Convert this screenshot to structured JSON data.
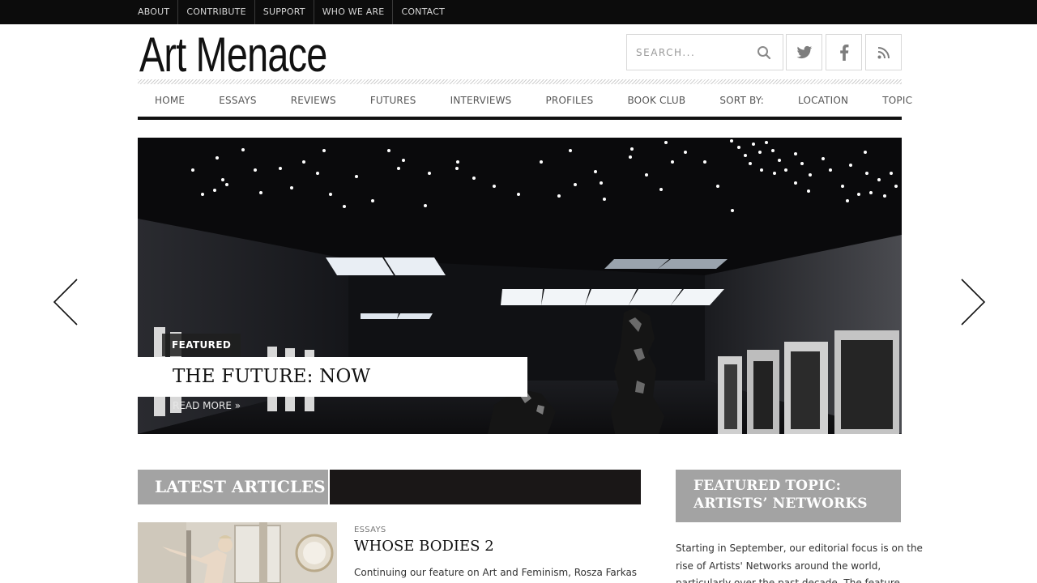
{
  "top_nav": [
    "ABOUT",
    "CONTRIBUTE",
    "SUPPORT",
    "WHO WE ARE",
    "CONTACT"
  ],
  "site": {
    "logo": "Art Menace"
  },
  "search": {
    "placeholder": "SEARCH..."
  },
  "social": [
    "twitter-icon",
    "facebook-icon",
    "rss-icon"
  ],
  "main_nav": [
    "HOME",
    "ESSAYS",
    "REVIEWS",
    "FUTURES",
    "INTERVIEWS",
    "PROFILES",
    "BOOK CLUB",
    "SORT BY:",
    "LOCATION",
    "TOPIC"
  ],
  "hero": {
    "tag": "FEATURED",
    "title": "THE FUTURE: NOW",
    "read_more": "READ MORE »"
  },
  "latest": {
    "heading": "LATEST ARTICLES",
    "article": {
      "category": "ESSAYS",
      "title": "WHOSE BODIES 2",
      "excerpt": "Continuing our feature on Art and Feminism, Rosza Farkas"
    }
  },
  "featured_topic": {
    "heading_line1": "FEATURED TOPIC:",
    "heading_line2": "ARTISTS’ NETWORKS",
    "text_lines": [
      "Starting in September, our editorial focus is on the",
      "rise of Artists' Networks around the world,",
      "particularly over the past decade. The feature"
    ]
  },
  "colors": {
    "topbar": "#0c0c0c",
    "section_label": "#a3a3a3",
    "section_bar": "#1a1717"
  }
}
